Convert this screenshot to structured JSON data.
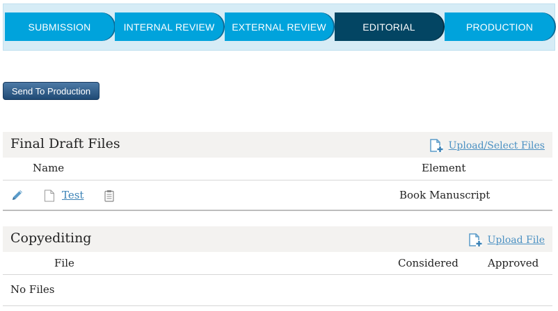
{
  "stages": [
    {
      "label": "SUBMISSION",
      "active": false
    },
    {
      "label": "INTERNAL REVIEW",
      "active": false
    },
    {
      "label": "EXTERNAL REVIEW",
      "active": false
    },
    {
      "label": "EDITORIAL",
      "active": true
    },
    {
      "label": "PRODUCTION",
      "active": false
    }
  ],
  "actions": {
    "send_to_production": "Send To Production"
  },
  "final_draft": {
    "title": "Final Draft Files",
    "upload_link": "Upload/Select Files",
    "columns": {
      "name": "Name",
      "element": "Element"
    },
    "rows": [
      {
        "name": "Test",
        "element": "Book Manuscript"
      }
    ]
  },
  "copyediting": {
    "title": "Copyediting",
    "upload_link": "Upload File",
    "columns": {
      "file": "File",
      "considered": "Considered",
      "approved": "Approved"
    },
    "empty_text": "No Files"
  },
  "icons": {
    "edit": "pencil-icon",
    "file": "document-icon",
    "notes": "clipboard-icon",
    "upload": "add-file-icon"
  },
  "colors": {
    "stage": "#00a3dc",
    "stage_active": "#034563",
    "stage_bar": "#d6ecf6",
    "button": "#2a5580",
    "link": "#4a90c2"
  }
}
